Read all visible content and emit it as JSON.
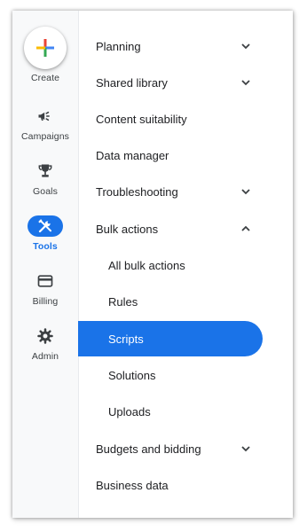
{
  "rail": {
    "items": [
      {
        "label": "Create",
        "icon": "plus-icon"
      },
      {
        "label": "Campaigns",
        "icon": "megaphone-icon"
      },
      {
        "label": "Goals",
        "icon": "trophy-icon"
      },
      {
        "label": "Tools",
        "icon": "wrench-icon",
        "active": true
      },
      {
        "label": "Billing",
        "icon": "credit-card-icon"
      },
      {
        "label": "Admin",
        "icon": "gear-icon"
      }
    ]
  },
  "menu": {
    "items": [
      {
        "label": "Planning",
        "expandable": true,
        "expanded": false
      },
      {
        "label": "Shared library",
        "expandable": true,
        "expanded": false
      },
      {
        "label": "Content suitability"
      },
      {
        "label": "Data manager"
      },
      {
        "label": "Troubleshooting",
        "expandable": true,
        "expanded": false
      },
      {
        "label": "Bulk actions",
        "expandable": true,
        "expanded": true
      },
      {
        "label": "All bulk actions",
        "level": 2
      },
      {
        "label": "Rules",
        "level": 2
      },
      {
        "label": "Scripts",
        "level": 2,
        "selected": true
      },
      {
        "label": "Solutions",
        "level": 2
      },
      {
        "label": "Uploads",
        "level": 2
      },
      {
        "label": "Budgets and bidding",
        "expandable": true,
        "expanded": false
      },
      {
        "label": "Business data"
      }
    ]
  },
  "colors": {
    "accent": "#1a73e8",
    "rail_bg": "#f8f9fa",
    "text": "#202124",
    "icon": "#3c4043"
  }
}
